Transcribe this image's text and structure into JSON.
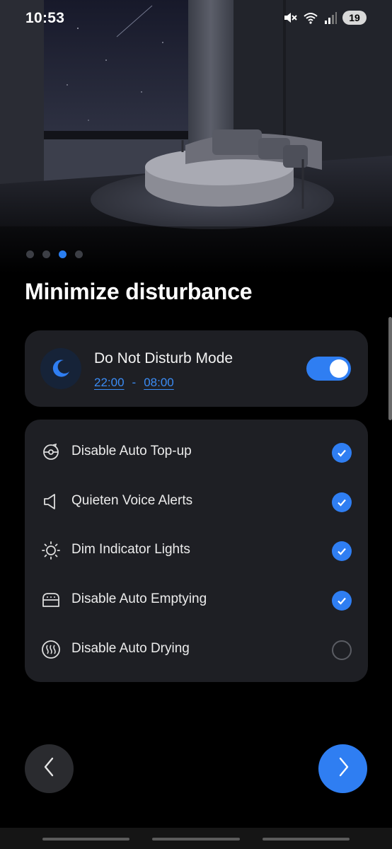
{
  "status_bar": {
    "time": "10:53",
    "battery": "19",
    "icons": [
      "mute-icon",
      "wifi-icon",
      "signal-icon"
    ]
  },
  "pager": {
    "count": 4,
    "active_index": 2
  },
  "title": "Minimize disturbance",
  "dnd": {
    "label": "Do Not Disturb Mode",
    "start_time": "22:00",
    "separator": "-",
    "end_time": "08:00",
    "enabled": true,
    "icon": "moon-icon"
  },
  "options": [
    {
      "label": "Disable Auto Top-up",
      "icon": "top-up-icon",
      "checked": true
    },
    {
      "label": "Quieten Voice Alerts",
      "icon": "speaker-icon",
      "checked": true
    },
    {
      "label": "Dim Indicator Lights",
      "icon": "sun-icon",
      "checked": true
    },
    {
      "label": "Disable Auto Emptying",
      "icon": "dustbin-icon",
      "checked": true
    },
    {
      "label": "Disable Auto Drying",
      "icon": "drying-icon",
      "checked": false
    }
  ],
  "navigation": {
    "prev_icon": "chevron-left-icon",
    "next_icon": "chevron-right-icon"
  },
  "colors": {
    "accent": "#2f7ef2",
    "card": "#1e1f24",
    "background": "#000000"
  }
}
